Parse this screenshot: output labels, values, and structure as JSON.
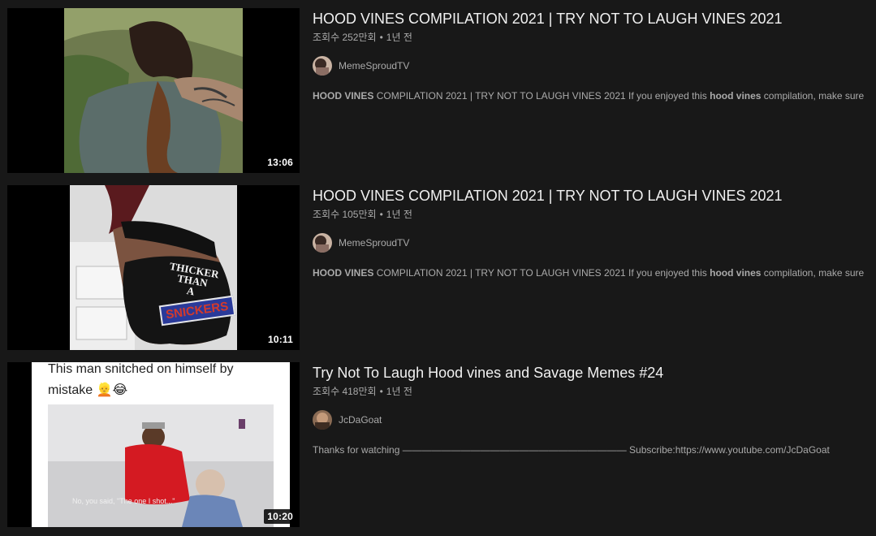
{
  "results": [
    {
      "title": "HOOD VINES COMPILATION 2021 | TRY NOT TO LAUGH VINES 2021",
      "views": "조회수 252만회",
      "age": "1년 전",
      "channel": "MemeSproudTV",
      "duration": "13:06",
      "snippet_b1": "HOOD VINES",
      "snippet_t1": " COMPILATION 2021 | TRY NOT TO LAUGH VINES 2021 If you enjoyed this ",
      "snippet_b2": "hood vines",
      "snippet_t2": " compilation, make sure to ..."
    },
    {
      "title": "HOOD VINES COMPILATION 2021 | TRY NOT TO LAUGH VINES 2021",
      "views": "조회수 105만회",
      "age": "1년 전",
      "channel": "MemeSproudTV",
      "duration": "10:11",
      "snippet_b1": "HOOD VINES",
      "snippet_t1": " COMPILATION 2021 | TRY NOT TO LAUGH VINES 2021 If you enjoyed this ",
      "snippet_b2": "hood vines",
      "snippet_t2": " compilation, make sure to ...",
      "thumb_text": [
        "THICKER",
        "THAN",
        "A",
        "SNICKERS"
      ]
    },
    {
      "title": "Try Not To Laugh Hood vines and Savage Memes #24",
      "views": "조회수 418만회",
      "age": "1년 전",
      "channel": "JcDaGoat",
      "duration": "10:20",
      "snippet": "Thanks for watching ——————————————————————— Subscribe:https://www.youtube.com/JcDaGoat",
      "thumb_caption_1": "This man snitched on himself by",
      "thumb_caption_2": "mistake 👱😂",
      "thumb_subtitle": "No, you said, \"The one I shot...\""
    }
  ],
  "icons": [
    "avatar-memesproudtv",
    "avatar-jcdagoat"
  ],
  "colors": {
    "background": "#181818",
    "title": "#f1f1f1",
    "secondary": "#aaaaaa"
  }
}
